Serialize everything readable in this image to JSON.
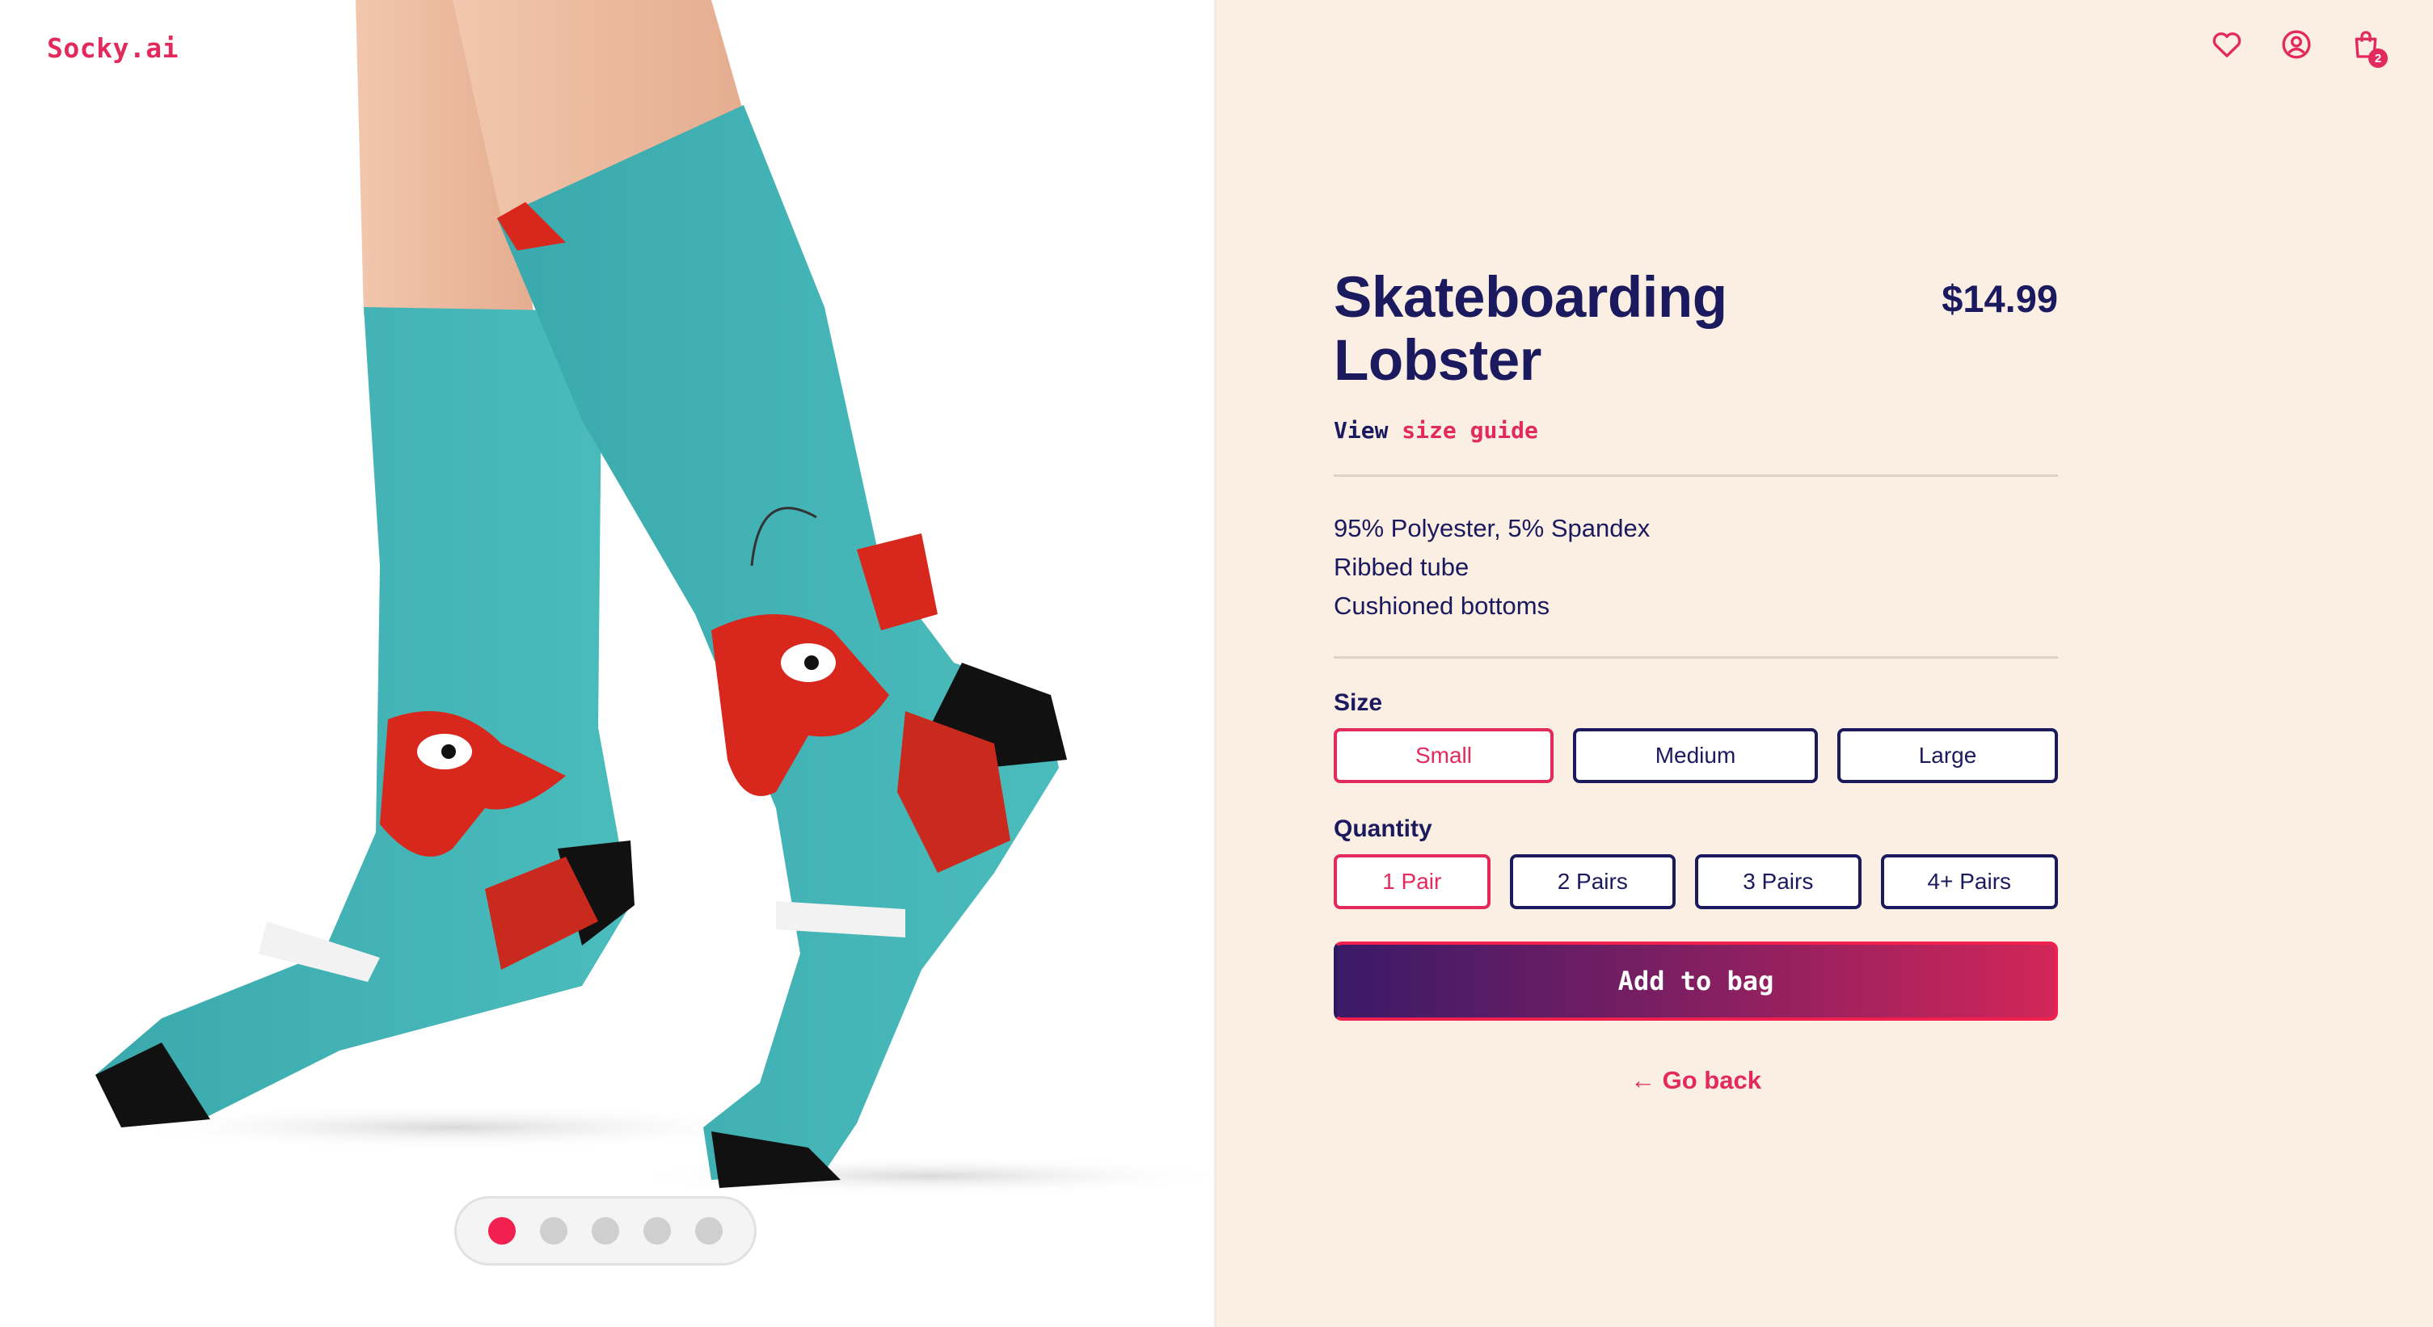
{
  "brand": {
    "logo": "Socky.ai"
  },
  "header": {
    "icons": [
      "heart-icon",
      "user-icon",
      "shopping-bag-icon"
    ],
    "cart_count": "2"
  },
  "product": {
    "title": "Skateboarding Lobster",
    "price": "$14.99",
    "size_guide_prefix": "View",
    "size_guide_link": "size guide",
    "specs": [
      "95% Polyester, 5% Spandex",
      "Ribbed tube",
      "Cushioned bottoms"
    ]
  },
  "size": {
    "label": "Size",
    "options": [
      "Small",
      "Medium",
      "Large"
    ],
    "selected": "Small"
  },
  "quantity": {
    "label": "Quantity",
    "options": [
      "1 Pair",
      "2 Pairs",
      "3 Pairs",
      "4+ Pairs"
    ],
    "selected": "1 Pair"
  },
  "actions": {
    "add_to_bag": "Add to bag",
    "go_back": "← Go back"
  },
  "gallery": {
    "image_count": 5,
    "active_index": 0
  },
  "colors": {
    "navy": "#1c1a5e",
    "accent": "#e22a5c",
    "panel_bg": "#faefe2",
    "sock_teal": "#3fb2b4",
    "lobster_red": "#d8281d"
  }
}
